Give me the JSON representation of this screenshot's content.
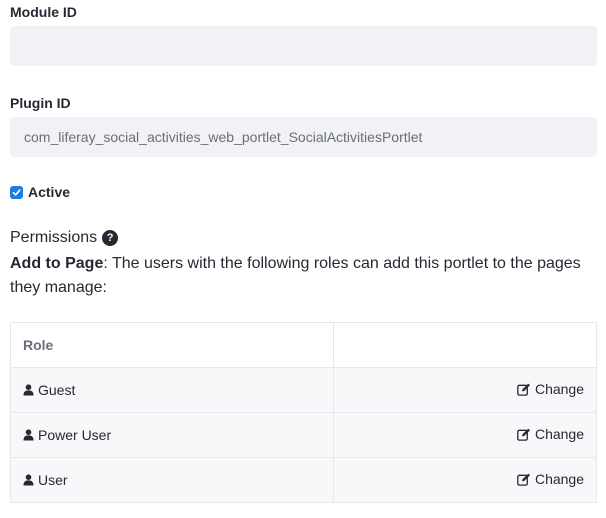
{
  "module_id": {
    "label": "Module ID",
    "value": ""
  },
  "plugin_id": {
    "label": "Plugin ID",
    "value": "com_liferay_social_activities_web_portlet_SocialActivitiesPortlet"
  },
  "active": {
    "label": "Active",
    "checked": true
  },
  "permissions": {
    "title": "Permissions",
    "help_icon_glyph": "?",
    "add_to_page_label": "Add to Page",
    "add_to_page_text": ": The users with the following roles can add this portlet to the pages they manage:"
  },
  "roles_table": {
    "header_role": "Role",
    "header_action": "",
    "rows": [
      {
        "role": "Guest",
        "action": "Change"
      },
      {
        "role": "Power User",
        "action": "Change"
      },
      {
        "role": "User",
        "action": "Change"
      }
    ]
  },
  "colors": {
    "accent": "#1e7be0",
    "field_bg": "#f1f2f5",
    "text": "#272833",
    "muted": "#6b6c7e",
    "border": "#e7e7ed"
  }
}
